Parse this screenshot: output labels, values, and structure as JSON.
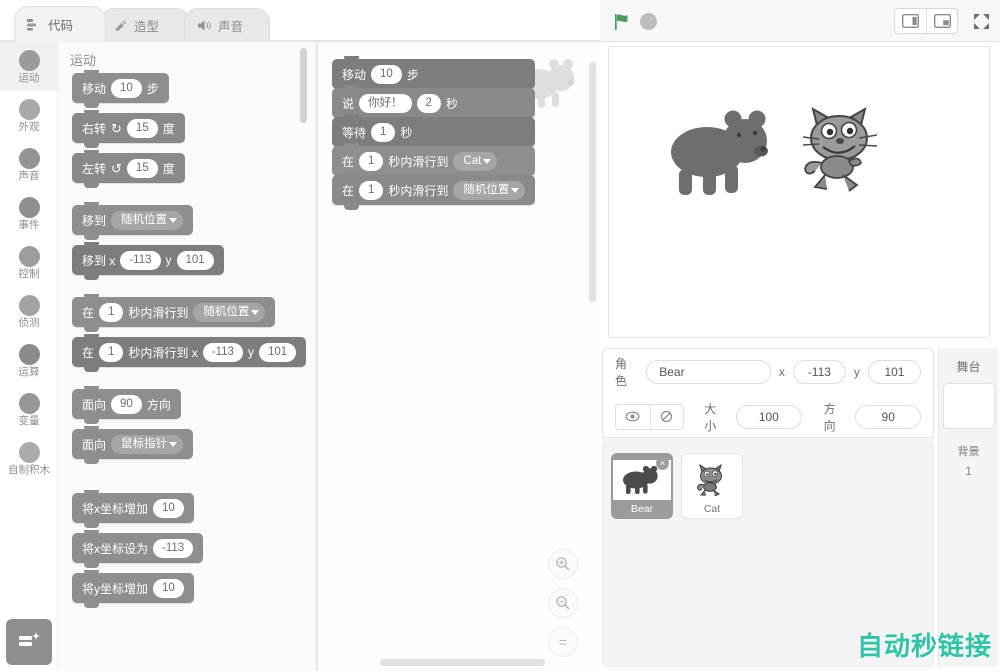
{
  "tabs": [
    {
      "label": "代码",
      "icon": "code-icon",
      "active": true
    },
    {
      "label": "造型",
      "icon": "brush-icon",
      "active": false
    },
    {
      "label": "声音",
      "icon": "speaker-icon",
      "active": false
    }
  ],
  "stage_controls": {
    "green_flag": "green-flag-icon",
    "stop": "stop-icon",
    "small_stage": "small-stage-layout-icon",
    "large_stage": "large-stage-layout-icon",
    "fullscreen": "fullscreen-icon",
    "flag_color": "#4c9c5e"
  },
  "categories": [
    {
      "label": "运动",
      "color": "#9a9a9a",
      "selected": true
    },
    {
      "label": "外观",
      "color": "#a8a8a8",
      "selected": false
    },
    {
      "label": "声音",
      "color": "#949494",
      "selected": false
    },
    {
      "label": "事件",
      "color": "#8f8f8f",
      "selected": false
    },
    {
      "label": "控制",
      "color": "#9d9d9d",
      "selected": false
    },
    {
      "label": "侦测",
      "color": "#a2a2a2",
      "selected": false
    },
    {
      "label": "运算",
      "color": "#8b8b8b",
      "selected": false
    },
    {
      "label": "变量",
      "color": "#979797",
      "selected": false
    },
    {
      "label": "自制积木",
      "color": "#ababab",
      "selected": false
    }
  ],
  "add_extension": {
    "label": "",
    "icon": "add-extension-icon"
  },
  "palette": {
    "header": "运动",
    "blocks": [
      {
        "id": "move-steps",
        "parts": [
          {
            "t": "text",
            "v": "移动"
          },
          {
            "t": "oval",
            "v": "10"
          },
          {
            "t": "text",
            "v": "步"
          }
        ]
      },
      {
        "id": "turn-right",
        "parts": [
          {
            "t": "text",
            "v": "右转"
          },
          {
            "t": "icon",
            "v": "↻"
          },
          {
            "t": "oval",
            "v": "15"
          },
          {
            "t": "text",
            "v": "度"
          }
        ]
      },
      {
        "id": "turn-left",
        "parts": [
          {
            "t": "text",
            "v": "左转"
          },
          {
            "t": "icon",
            "v": "↺"
          },
          {
            "t": "oval",
            "v": "15"
          },
          {
            "t": "text",
            "v": "度"
          }
        ]
      },
      {
        "id": "goto-random",
        "gap": true,
        "parts": [
          {
            "t": "text",
            "v": "移到"
          },
          {
            "t": "drop",
            "v": "随机位置"
          }
        ]
      },
      {
        "id": "goto-xy",
        "parts": [
          {
            "t": "text",
            "v": "移到 x"
          },
          {
            "t": "oval",
            "v": "-113"
          },
          {
            "t": "text",
            "v": "y"
          },
          {
            "t": "oval",
            "v": "101"
          }
        ]
      },
      {
        "id": "glide-random",
        "gap": true,
        "parts": [
          {
            "t": "text",
            "v": "在"
          },
          {
            "t": "oval",
            "v": "1"
          },
          {
            "t": "text",
            "v": "秒内滑行到"
          },
          {
            "t": "drop",
            "v": "随机位置"
          }
        ]
      },
      {
        "id": "glide-xy",
        "parts": [
          {
            "t": "text",
            "v": "在"
          },
          {
            "t": "oval",
            "v": "1"
          },
          {
            "t": "text",
            "v": "秒内滑行到 x"
          },
          {
            "t": "oval",
            "v": "-113"
          },
          {
            "t": "text",
            "v": "y"
          },
          {
            "t": "oval",
            "v": "101"
          }
        ]
      },
      {
        "id": "point-direction",
        "gap": true,
        "parts": [
          {
            "t": "text",
            "v": "面向"
          },
          {
            "t": "oval",
            "v": "90"
          },
          {
            "t": "text",
            "v": "方向"
          }
        ]
      },
      {
        "id": "point-towards",
        "parts": [
          {
            "t": "text",
            "v": "面向"
          },
          {
            "t": "drop",
            "v": "鼠标指针"
          }
        ]
      },
      {
        "id": "change-x-by",
        "gap": true,
        "parts": [
          {
            "t": "text",
            "v": "将x坐标增加"
          },
          {
            "t": "oval",
            "v": "10"
          }
        ]
      },
      {
        "id": "set-x-to",
        "parts": [
          {
            "t": "text",
            "v": "将x坐标设为"
          },
          {
            "t": "oval",
            "v": "-113"
          }
        ]
      },
      {
        "id": "change-y-by",
        "parts": [
          {
            "t": "text",
            "v": "将y坐标增加"
          },
          {
            "t": "oval",
            "v": "10"
          }
        ]
      }
    ]
  },
  "script": {
    "blocks": [
      {
        "id": "script-move",
        "parts": [
          {
            "t": "text",
            "v": "移动"
          },
          {
            "t": "oval",
            "v": "10"
          },
          {
            "t": "text",
            "v": "步"
          }
        ]
      },
      {
        "id": "script-say",
        "parts": [
          {
            "t": "text",
            "v": "说"
          },
          {
            "t": "oval",
            "v": "你好！"
          },
          {
            "t": "oval",
            "v": "2"
          },
          {
            "t": "text",
            "v": "秒"
          }
        ]
      },
      {
        "id": "script-wait",
        "parts": [
          {
            "t": "text",
            "v": "等待"
          },
          {
            "t": "oval",
            "v": "1"
          },
          {
            "t": "text",
            "v": "秒"
          }
        ]
      },
      {
        "id": "script-glide-cat",
        "parts": [
          {
            "t": "text",
            "v": "在"
          },
          {
            "t": "oval",
            "v": "1"
          },
          {
            "t": "text",
            "v": "秒内滑行到"
          },
          {
            "t": "drop",
            "v": "Cat"
          }
        ]
      },
      {
        "id": "script-glide-random",
        "parts": [
          {
            "t": "text",
            "v": "在"
          },
          {
            "t": "oval",
            "v": "1"
          },
          {
            "t": "text",
            "v": "秒内滑行到"
          },
          {
            "t": "drop",
            "v": "随机位置"
          }
        ]
      }
    ]
  },
  "zoom_controls": [
    {
      "id": "zoom-in",
      "glyph": "＋"
    },
    {
      "id": "zoom-out",
      "glyph": "－"
    },
    {
      "id": "zoom-reset",
      "glyph": "="
    }
  ],
  "stage": {
    "sprites_on_stage": [
      {
        "name": "Bear",
        "icon": "bear-icon"
      },
      {
        "name": "Cat",
        "icon": "cat-icon"
      }
    ]
  },
  "sprite_info": {
    "name_label": "角色",
    "name_value": "Bear",
    "x_label": "x",
    "x_value": "-113",
    "y_label": "y",
    "y_value": "101",
    "show_icon": "eye-visible-icon",
    "hide_icon": "eye-hidden-icon",
    "size_label": "大小",
    "size_value": "100",
    "direction_label": "方向",
    "direction_value": "90"
  },
  "sprite_list": [
    {
      "name": "Bear",
      "icon": "bear-icon",
      "selected": true,
      "delete_badge": "×"
    },
    {
      "name": "Cat",
      "icon": "cat-icon",
      "selected": false,
      "delete_badge": ""
    }
  ],
  "stage_panel": {
    "title": "舞台",
    "backdrop_label": "背景",
    "backdrop_count": "1"
  },
  "watermark": {
    "text": "自动秒链接",
    "color": "#2ec4a6"
  }
}
